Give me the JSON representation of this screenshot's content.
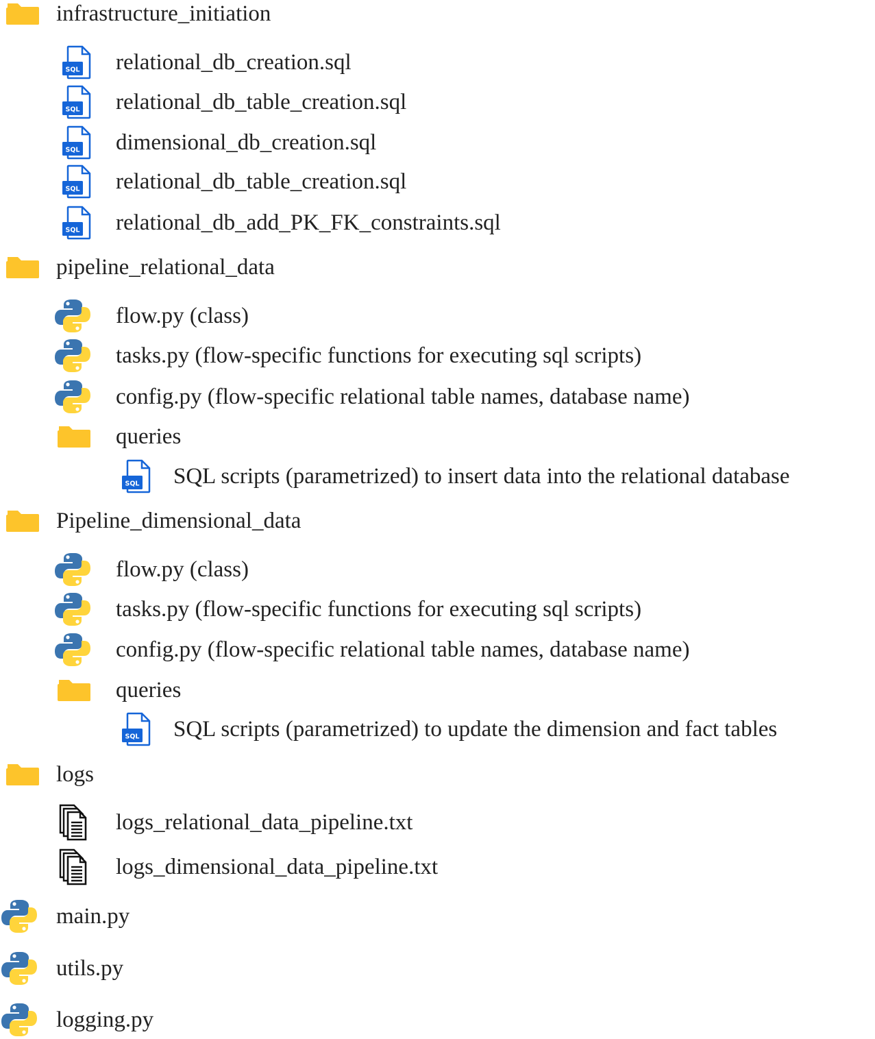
{
  "colors": {
    "folder": "#FDC42B",
    "python_blue": "#3B75B0",
    "python_yellow": "#FFD43B",
    "sql_blue": "#1565D8",
    "text": "#222222"
  },
  "tree": [
    {
      "type": "folder",
      "label": "infrastructure_initiation"
    },
    {
      "type": "sql",
      "label": "relational_db_creation.sql"
    },
    {
      "type": "sql",
      "label": "relational_db_table_creation.sql"
    },
    {
      "type": "sql",
      "label": "dimensional_db_creation.sql"
    },
    {
      "type": "sql",
      "label": "relational_db_table_creation.sql"
    },
    {
      "type": "sql",
      "label": "relational_db_add_PK_FK_constraints.sql"
    },
    {
      "type": "folder",
      "label": "pipeline_relational_data"
    },
    {
      "type": "python",
      "label": "flow.py (class)"
    },
    {
      "type": "python",
      "label": "tasks.py (flow-specific functions for executing sql scripts)"
    },
    {
      "type": "python",
      "label": "config.py (flow-specific relational table names, database name)"
    },
    {
      "type": "folder",
      "label": "queries"
    },
    {
      "type": "sql",
      "label": "SQL scripts (parametrized) to insert data into the relational database"
    },
    {
      "type": "folder",
      "label": "Pipeline_dimensional_data"
    },
    {
      "type": "python",
      "label": "flow.py (class)"
    },
    {
      "type": "python",
      "label": "tasks.py (flow-specific functions for executing sql scripts)"
    },
    {
      "type": "python",
      "label": "config.py (flow-specific relational table names, database name)"
    },
    {
      "type": "folder",
      "label": "queries"
    },
    {
      "type": "sql",
      "label": "SQL scripts (parametrized) to update the dimension and fact tables"
    },
    {
      "type": "folder",
      "label": "logs"
    },
    {
      "type": "text",
      "label": "logs_relational_data_pipeline.txt"
    },
    {
      "type": "text",
      "label": "logs_dimensional_data_pipeline.txt"
    },
    {
      "type": "python",
      "label": "main.py"
    },
    {
      "type": "python",
      "label": "utils.py"
    },
    {
      "type": "python",
      "label": "logging.py"
    }
  ]
}
